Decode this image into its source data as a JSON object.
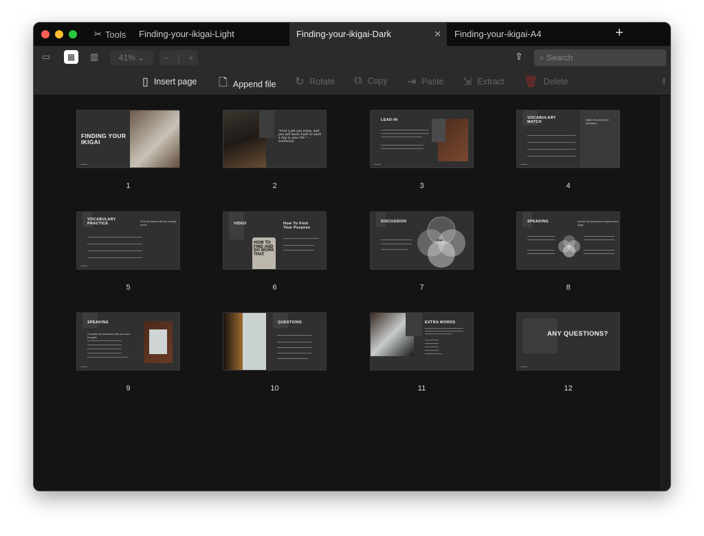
{
  "tabs": {
    "tools": "Tools",
    "items": [
      {
        "label": "Finding-your-ikigai-Light",
        "active": false
      },
      {
        "label": "Finding-your-ikigai-Dark",
        "active": true
      },
      {
        "label": "Finding-your-ikigai-A4",
        "active": false
      }
    ]
  },
  "toolbar": {
    "zoom": "41%",
    "search_placeholder": "Search",
    "actions": [
      {
        "label": "Insert page",
        "icon": "insert-page-icon",
        "enabled": true
      },
      {
        "label": "Append file",
        "icon": "append-file-icon",
        "enabled": true
      },
      {
        "label": "Rotate",
        "icon": "rotate-icon",
        "enabled": false
      },
      {
        "label": "Copy",
        "icon": "copy-icon",
        "enabled": false
      },
      {
        "label": "Paste",
        "icon": "paste-icon",
        "enabled": false
      },
      {
        "label": "Extract",
        "icon": "extract-icon",
        "enabled": false
      },
      {
        "label": "Delete",
        "icon": "trash-icon",
        "enabled": false
      }
    ]
  },
  "colors": {
    "traffic_red": "#ff5f57",
    "traffic_yellow": "#febc2e",
    "traffic_green": "#28c840",
    "delete": "#8c2a2a"
  },
  "pages": [
    {
      "number": "1",
      "title": "FINDING YOUR IKIGAI"
    },
    {
      "number": "2",
      "title": "\"Find a job you enjoy, and you will never have to work a day in your life.\" – Confucius"
    },
    {
      "number": "3",
      "title": "LEAD-IN"
    },
    {
      "number": "4",
      "title": "VOCABULARY MATCH",
      "subtitle": "Match the words and definitions"
    },
    {
      "number": "5",
      "title": "VOCABULARY PRACTICE",
      "subtitle": "Fill in the blanks with the missing words"
    },
    {
      "number": "6",
      "title": "VIDEO",
      "subtitle": "How To Find Your Purpose",
      "phone": "HOW TO FIND AND DO WORK THAT"
    },
    {
      "number": "7",
      "title": "DISCUSSION",
      "center": "Ikigai"
    },
    {
      "number": "8",
      "title": "SPEAKING",
      "subtitle": "Answer the questions to explore your Ikigai"
    },
    {
      "number": "9",
      "title": "SPEAKING",
      "subtitle": "Complete the sentences with your own thoughts"
    },
    {
      "number": "10",
      "title": "QUESTIONS"
    },
    {
      "number": "11",
      "title": "EXTRA WORDS"
    },
    {
      "number": "12",
      "title": "ANY QUESTIONS?"
    }
  ]
}
